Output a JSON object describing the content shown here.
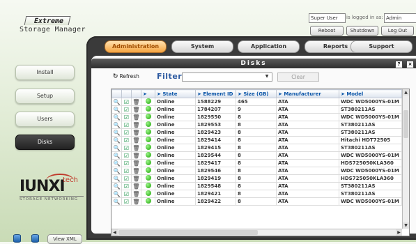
{
  "app": {
    "title_line1": "Extreme",
    "title_line2": "Storage Manager"
  },
  "session": {
    "user_label": "Super User",
    "logged_in_text": "is logged in as:",
    "username": "Admin",
    "reboot": "Reboot",
    "shutdown": "Shutdown",
    "logout": "Log Out"
  },
  "tabs": [
    "Administration",
    "System",
    "Application",
    "Reports",
    "Support"
  ],
  "sidebar": [
    "Install",
    "Setup",
    "Users",
    "Disks"
  ],
  "logo": {
    "name": "IUNXI",
    "tech": "tech",
    "sub": "STORAGE NETWORKING"
  },
  "footer": {
    "view_xml": "View XML"
  },
  "panel": {
    "title": "Disks",
    "help": "?",
    "close": "×"
  },
  "toolbar": {
    "refresh": "Refresh",
    "filter_label": "Filter",
    "filter_value": "",
    "clear": "Clear"
  },
  "table": {
    "headers": [
      "State",
      "Element ID",
      "Size (GB)",
      "Manufacturer",
      "Model"
    ],
    "rows": [
      [
        "Online",
        "1588229",
        "465",
        "ATA",
        "WDC WD5000YS-01M"
      ],
      [
        "Online",
        "1784207",
        "9",
        "ATA",
        "ST380211AS"
      ],
      [
        "Online",
        "1829550",
        "8",
        "ATA",
        "WDC WD5000YS-01M"
      ],
      [
        "Online",
        "1829553",
        "8",
        "ATA",
        "ST380211AS"
      ],
      [
        "Online",
        "1829423",
        "8",
        "ATA",
        "ST380211AS"
      ],
      [
        "Online",
        "1829414",
        "8",
        "ATA",
        "Hitachi HDT72505"
      ],
      [
        "Online",
        "1829415",
        "8",
        "ATA",
        "ST380211AS"
      ],
      [
        "Online",
        "1829544",
        "8",
        "ATA",
        "WDC WD5000YS-01M"
      ],
      [
        "Online",
        "1829417",
        "8",
        "ATA",
        "HDS725050KLA360"
      ],
      [
        "Online",
        "1829546",
        "8",
        "ATA",
        "WDC WD5000YS-01M"
      ],
      [
        "Online",
        "1829419",
        "8",
        "ATA",
        "HDS725050KLA360"
      ],
      [
        "Online",
        "1829548",
        "8",
        "ATA",
        "ST380211AS"
      ],
      [
        "Online",
        "1829421",
        "8",
        "ATA",
        "ST380211AS"
      ],
      [
        "Online",
        "1829422",
        "8",
        "ATA",
        "WDC WD5000YS-01M"
      ]
    ]
  },
  "colors": {
    "accent": "#f5a441",
    "header_text": "#0a55a8",
    "online": "#17a000"
  }
}
